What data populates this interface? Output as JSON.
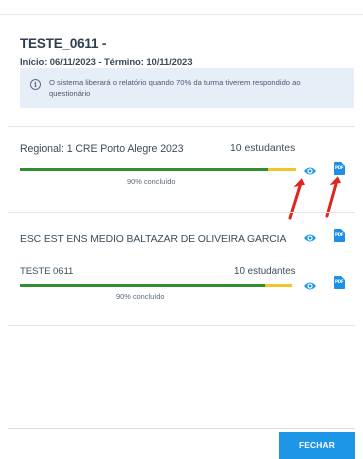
{
  "assessment": {
    "title": "TESTE_0611 -",
    "dates": "Início: 06/11/2023 - Término: 10/11/2023",
    "info": "O sistema liberará o relatório quando 70% da turma tiverem respondido ao questionário",
    "info_icon": "info-icon"
  },
  "rows": [
    {
      "title": "Regional: 1 CRE Porto Alegre 2023",
      "students": "10 estudantes",
      "progress_label": "90% concluído",
      "progress": 0.9
    },
    {
      "school": "ESC EST ENS MEDIO BALTAZAR DE OLIVEIRA GARCIA",
      "title": "TESTE 0611",
      "students": "10 estudantes",
      "progress_label": "90% concluído",
      "progress": 0.9
    }
  ],
  "icons": {
    "view": "eye-icon",
    "pdf": "pdf-icon",
    "pdf_text": "PDF"
  },
  "footer": {
    "close_label": "FECHAR"
  },
  "colors": {
    "accent": "#1d96e8",
    "progress_done": "#2f8f2f",
    "progress_remaining": "#f2c52b",
    "annotation_arrow": "#e0251b",
    "info_background": "#e6eef8"
  }
}
